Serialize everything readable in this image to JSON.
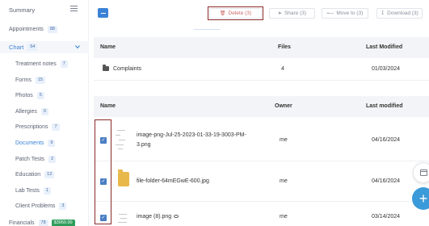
{
  "sidebar": {
    "summary": "Summary",
    "items": [
      {
        "label": "Appointments",
        "count": "88"
      },
      {
        "label": "Chart",
        "count": "54"
      },
      {
        "label": "Treatment notes",
        "count": "7"
      },
      {
        "label": "Forms",
        "count": "15"
      },
      {
        "label": "Photos",
        "count": "5"
      },
      {
        "label": "Allergies",
        "count": "0"
      },
      {
        "label": "Prescriptions",
        "count": "7"
      },
      {
        "label": "Documents",
        "count": "9"
      },
      {
        "label": "Patch Tests",
        "count": "2"
      },
      {
        "label": "Education",
        "count": "12"
      },
      {
        "label": "Lab Tests",
        "count": "1"
      },
      {
        "label": "Client Problems",
        "count": "3"
      },
      {
        "label": "Financials",
        "count": "78",
        "amount": "$3950.00"
      }
    ]
  },
  "toolbar": {
    "delete_label": "Delete (3)",
    "share_label": "Share (3)",
    "move_label": "Move to (3)",
    "download_label": "Download (3)"
  },
  "folders": {
    "columns": {
      "name": "Name",
      "files": "Files",
      "last_modified": "Last Modified"
    },
    "rows": [
      {
        "name": "Complaints",
        "files": "4",
        "last_modified": "01/03/2024"
      }
    ]
  },
  "files": {
    "columns": {
      "name": "Name",
      "owner": "Owner",
      "last_modified": "Last modified"
    },
    "rows": [
      {
        "name_line1": "image-png-Jul-25-2023-01-33-19-3003-PM-",
        "name_line2": "3.png",
        "owner": "me",
        "last_modified": "04/16/2024",
        "checked": true
      },
      {
        "name_line1": "file-folder-64mEGwE-600.jpg",
        "owner": "me",
        "last_modified": "04/16/2024",
        "checked": true
      },
      {
        "name_line1": "image (8).png",
        "owner": "me",
        "last_modified": "03/14/2024",
        "checked": true
      }
    ]
  },
  "colors": {
    "accent": "#3b82d6",
    "highlight_box": "#8b2a2a",
    "money_badge": "#2e9d5b"
  }
}
